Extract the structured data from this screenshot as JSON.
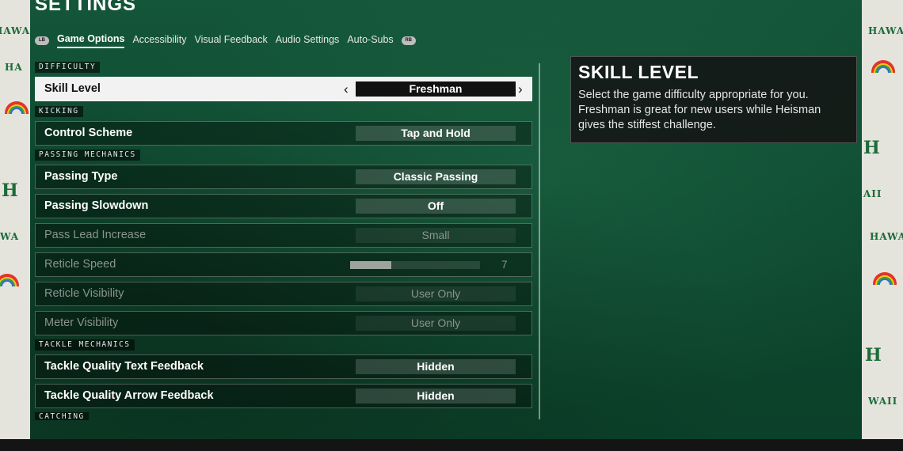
{
  "page": {
    "title": "SETTINGS"
  },
  "tabs": {
    "left_hint": "LB",
    "right_hint": "RB",
    "items": [
      {
        "label": "Game Options",
        "active": true
      },
      {
        "label": "Accessibility"
      },
      {
        "label": "Visual Feedback"
      },
      {
        "label": "Audio Settings"
      },
      {
        "label": "Auto-Subs"
      }
    ]
  },
  "sections": {
    "difficulty": "DIFFICULTY",
    "kicking": "KICKING",
    "passing": "PASSING MECHANICS",
    "tackle": "TACKLE MECHANICS",
    "catching": "CATCHING"
  },
  "rows": {
    "skill_level": {
      "label": "Skill Level",
      "value": "Freshman",
      "left_arrow": "‹",
      "right_arrow": "›"
    },
    "control_scheme": {
      "label": "Control Scheme",
      "value": "Tap and Hold"
    },
    "passing_type": {
      "label": "Passing Type",
      "value": "Classic Passing"
    },
    "passing_slowdown": {
      "label": "Passing Slowdown",
      "value": "Off"
    },
    "pass_lead": {
      "label": "Pass Lead Increase",
      "value": "Small"
    },
    "reticle_speed": {
      "label": "Reticle Speed",
      "value": "7",
      "fill": 0.32
    },
    "reticle_visibility": {
      "label": "Reticle Visibility",
      "value": "User Only"
    },
    "meter_visibility": {
      "label": "Meter Visibility",
      "value": "User Only"
    },
    "tackle_text": {
      "label": "Tackle Quality Text Feedback",
      "value": "Hidden"
    },
    "tackle_arrow": {
      "label": "Tackle Quality Arrow Feedback",
      "value": "Hidden"
    }
  },
  "help": {
    "title": "SKILL LEVEL",
    "text": "Select the game difficulty appropriate for you. Freshman is great for new users while Heisman gives the stiffest challenge."
  },
  "background": {
    "side_text": "HAWAI",
    "side_text_right": "HAWAI",
    "side_text_short": "WAII",
    "side_text_aii": "AII",
    "side_text_ha": "HA",
    "side_text_wa": "WA",
    "h_letter": "H",
    "colors": {
      "green": "#0e4a30",
      "accent": "#1d6b3a"
    }
  }
}
